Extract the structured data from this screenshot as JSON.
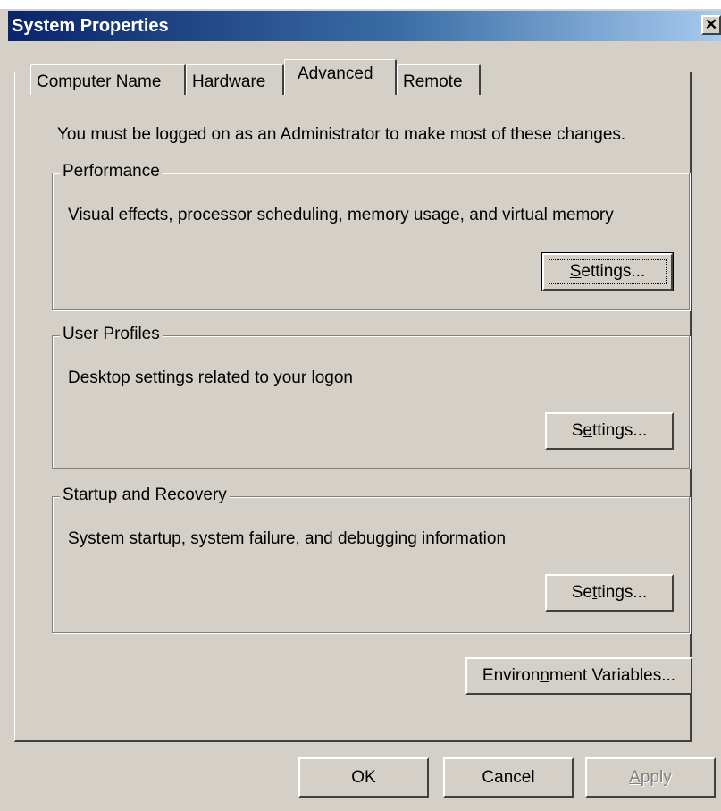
{
  "window": {
    "title": "System Properties",
    "close_glyph": "✕",
    "close_icon": "close-icon"
  },
  "tabs": [
    {
      "label": "Computer Name",
      "selected": false
    },
    {
      "label": "Hardware",
      "selected": false
    },
    {
      "label": "Advanced",
      "selected": true
    },
    {
      "label": "Remote",
      "selected": false
    }
  ],
  "advanced": {
    "note": "You must be logged on as an Administrator to make most of these changes.",
    "performance": {
      "title": "Performance",
      "description": "Visual effects, processor scheduling, memory usage, and virtual memory",
      "button": {
        "pre": "",
        "mnemonic": "S",
        "post": "ettings...",
        "focused": true
      }
    },
    "user_profiles": {
      "title": "User Profiles",
      "description": "Desktop settings related to your logon",
      "button": {
        "pre": "S",
        "mnemonic": "e",
        "post": "ttings..."
      }
    },
    "startup_recovery": {
      "title": "Startup and Recovery",
      "description": "System startup, system failure, and debugging information",
      "button": {
        "pre": "Se",
        "mnemonic": "t",
        "post": "tings..."
      }
    },
    "environment_button": {
      "pre": "Environ",
      "mnemonic": "n",
      "post": "ment Variables..."
    }
  },
  "footer": {
    "ok": "OK",
    "cancel": "Cancel",
    "apply": {
      "pre": "",
      "mnemonic": "A",
      "post": "pply",
      "enabled": false
    }
  },
  "colors": {
    "face": "#d4d0c8",
    "title_start": "#0a246a",
    "title_end": "#a6caf0",
    "disabled_text": "#808080"
  }
}
